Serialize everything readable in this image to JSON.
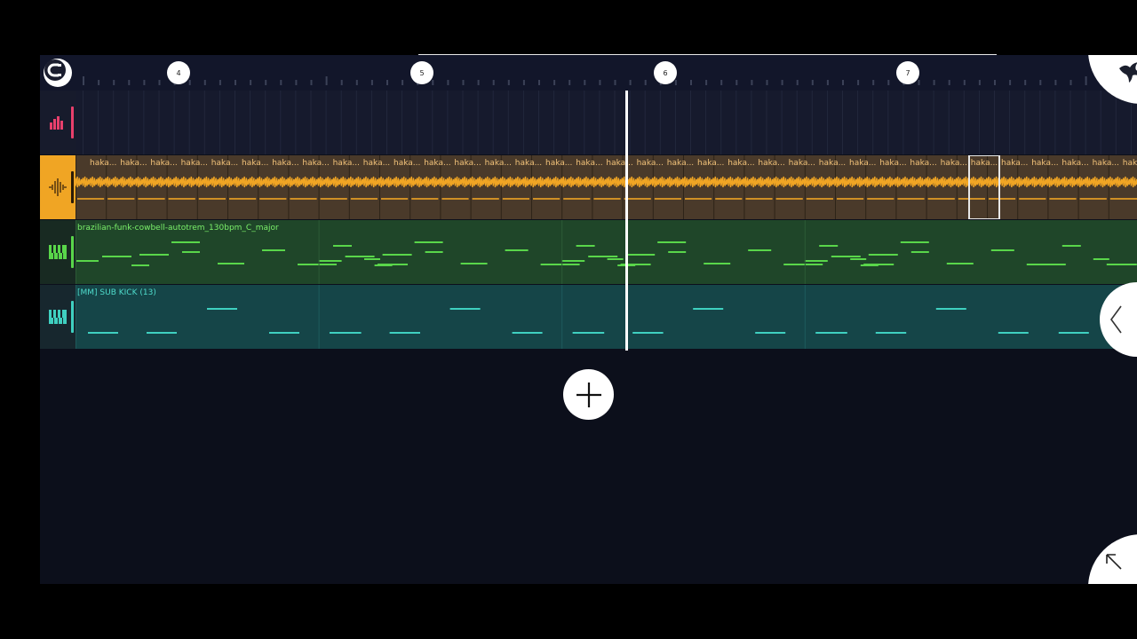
{
  "ruler": {
    "bars": [
      {
        "label": "4"
      },
      {
        "label": "5"
      },
      {
        "label": "6"
      },
      {
        "label": "7"
      }
    ]
  },
  "tracks": {
    "drums": {
      "icon": "drum-pads-icon",
      "color": "#e8406c"
    },
    "audio": {
      "icon": "waveform-icon",
      "color": "#f0a524",
      "clip_label": "haka..."
    },
    "synth": {
      "icon": "piano-keys-icon",
      "color": "#59d64a",
      "clip_name": "brazilian-funk-cowbell-autotrem_130bpm_C_major"
    },
    "kick": {
      "icon": "piano-keys-icon",
      "color": "#3fd0c0",
      "clip_name": "[MM] SUB KICK (13)"
    }
  },
  "buttons": {
    "snap": "magnet-icon",
    "add_track": "plus-icon",
    "menu": "phoenix-logo-icon",
    "collapse_panel": "chevron-left-icon",
    "expand": "arrow-up-left-icon"
  }
}
